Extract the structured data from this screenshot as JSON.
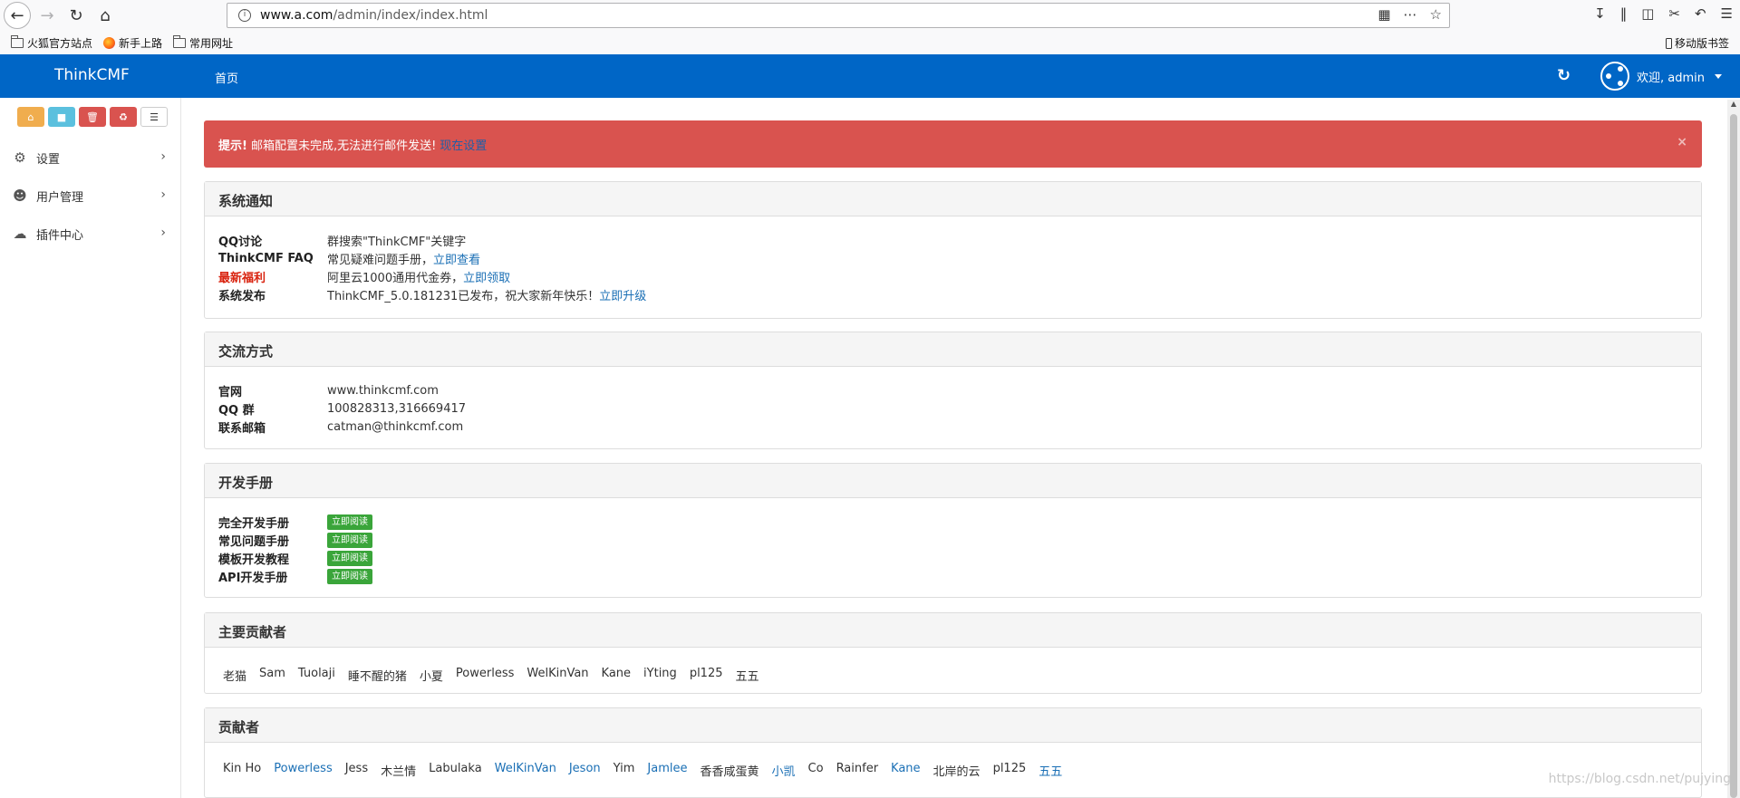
{
  "browser": {
    "url_prefix": "www.a.com",
    "url_path": "/admin/index/index.html",
    "bookmarks": [
      "火狐官方站点",
      "新手上路",
      "常用网址"
    ],
    "mobile_bookmarks": "移动版书签"
  },
  "navbar": {
    "brand": "ThinkCMF",
    "home": "首页",
    "welcome": "欢迎, admin"
  },
  "sidebar": {
    "menu": [
      {
        "label": "设置",
        "icon": "gears-icon"
      },
      {
        "label": "用户管理",
        "icon": "users-icon"
      },
      {
        "label": "插件中心",
        "icon": "cloud-icon"
      }
    ]
  },
  "alert": {
    "strong": "提示!",
    "text": "邮箱配置未完成,无法进行邮件发送!",
    "link": "现在设置",
    "close": "×"
  },
  "notice_panel": {
    "title": "系统通知",
    "rows": [
      {
        "key": "QQ讨论",
        "value": "群搜索\"ThinkCMF\"关键字",
        "link": ""
      },
      {
        "key": "ThinkCMF FAQ",
        "value": "常见疑难问题手册，",
        "link": "立即查看"
      },
      {
        "key": "最新福利",
        "value": "阿里云1000通用代金券，",
        "link": "立即领取"
      },
      {
        "key": "系统发布",
        "value": "ThinkCMF_5.0.181231已发布，祝大家新年快乐！",
        "link": "立即升级"
      }
    ]
  },
  "contact_panel": {
    "title": "交流方式",
    "rows": [
      {
        "key": "官网",
        "value": "www.thinkcmf.com"
      },
      {
        "key": "QQ 群",
        "value": "100828313,316669417"
      },
      {
        "key": "联系邮箱",
        "value": "catman@thinkcmf.com"
      }
    ]
  },
  "manual_panel": {
    "title": "开发手册",
    "button_label": "立即阅读",
    "rows": [
      "完全开发手册",
      "常见问题手册",
      "模板开发教程",
      "API开发手册"
    ]
  },
  "main_contrib_panel": {
    "title": "主要贡献者",
    "names": [
      "老猫",
      "Sam",
      "Tuolaji",
      "睡不醒的猪",
      "小夏",
      "Powerless",
      "WelKinVan",
      "Kane",
      "iYting",
      "pl125",
      "五五"
    ]
  },
  "contrib_panel": {
    "title": "贡献者",
    "names": [
      {
        "name": "Kin Ho",
        "linked": false
      },
      {
        "name": "Powerless",
        "linked": true
      },
      {
        "name": "Jess",
        "linked": false
      },
      {
        "name": "木兰情",
        "linked": false
      },
      {
        "name": "Labulaka",
        "linked": false
      },
      {
        "name": "WelKinVan",
        "linked": true
      },
      {
        "name": "Jeson",
        "linked": true
      },
      {
        "name": "Yim",
        "linked": false
      },
      {
        "name": "Jamlee",
        "linked": true
      },
      {
        "name": "香香咸蛋黄",
        "linked": false
      },
      {
        "name": "小凯",
        "linked": true
      },
      {
        "name": "Co",
        "linked": false
      },
      {
        "name": "Rainfer",
        "linked": false
      },
      {
        "name": "Kane",
        "linked": true
      },
      {
        "name": "北岸的云",
        "linked": false
      },
      {
        "name": "pl125",
        "linked": false
      },
      {
        "name": "五五",
        "linked": true
      }
    ]
  },
  "watermark": "https://blog.csdn.net/pujying",
  "colors": {
    "navbar": "#0066c6",
    "alert": "#d9534f",
    "read_button": "#3aa53a",
    "link": "#1a6fb5"
  }
}
